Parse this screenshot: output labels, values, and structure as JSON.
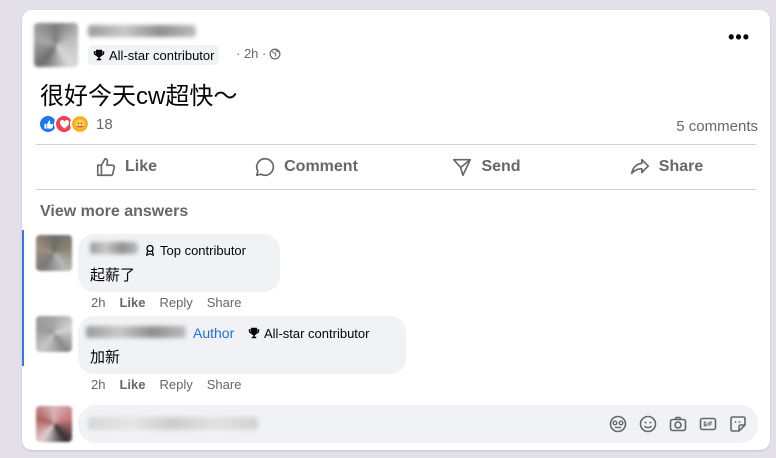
{
  "post": {
    "badge": "All-star contributor",
    "time": "· 2h ·",
    "text": "很好今天cw超快～",
    "reaction_count": "18",
    "comment_count": "5 comments",
    "more_label": "•••"
  },
  "actions": {
    "like": "Like",
    "comment": "Comment",
    "send": "Send",
    "share": "Share"
  },
  "view_more": "View more answers",
  "comments": [
    {
      "badge": "Top contributor",
      "text": "起薪了",
      "time": "2h",
      "like": "Like",
      "reply": "Reply",
      "share": "Share"
    },
    {
      "author_tag": "Author",
      "badge": "All-star contributor",
      "text": "加新",
      "time": "2h",
      "like": "Like",
      "reply": "Reply",
      "share": "Share"
    }
  ],
  "composer": {
    "icons": [
      "avatar-sticker-icon",
      "emoji-icon",
      "camera-icon",
      "gif-icon",
      "sticker-icon"
    ]
  },
  "colors": {
    "accent": "#1877f2",
    "love": "#f33e58",
    "care": "#f7b125",
    "author": "#216fdb",
    "thread": "#3578e5"
  }
}
